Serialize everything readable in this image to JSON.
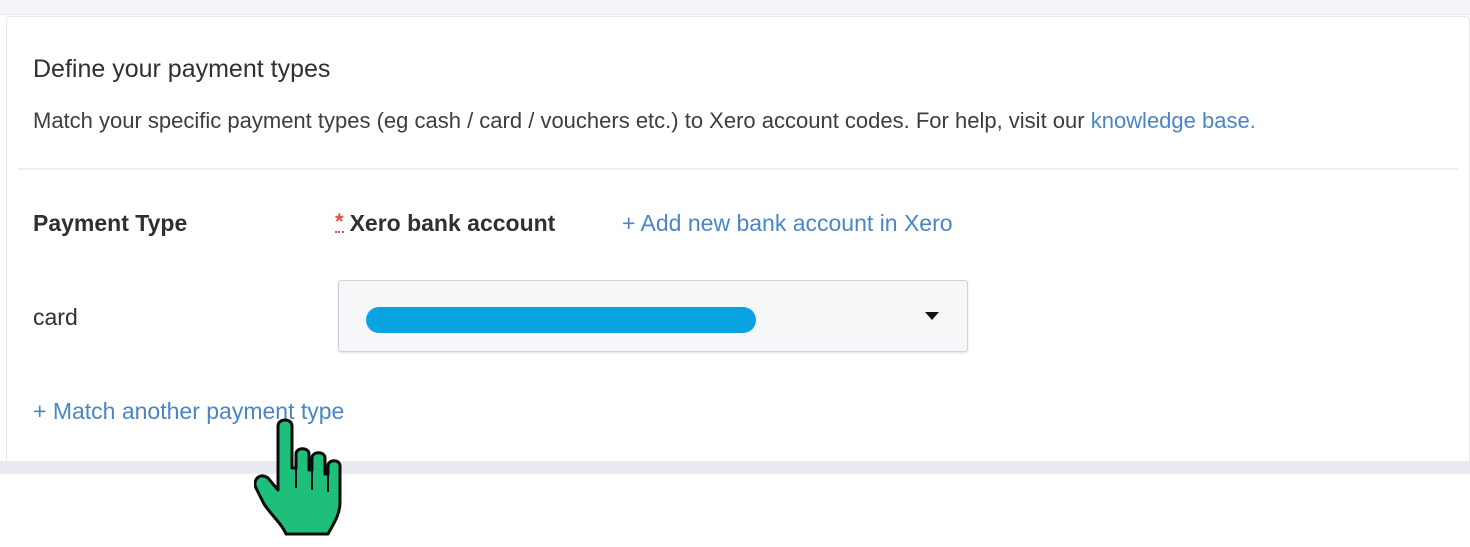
{
  "section": {
    "title": "Define your payment types",
    "description_prefix": "Match your specific payment types (eg cash / card / vouchers etc.) to Xero account codes. For help, visit our ",
    "knowledge_base_link": "knowledge base."
  },
  "table": {
    "col_payment_type": "Payment Type",
    "required_marker": "*",
    "col_bank_account": "Xero bank account",
    "add_bank_link": "+ Add new bank account in Xero",
    "rows": [
      {
        "payment_type": "card",
        "bank_account_value": ""
      }
    ]
  },
  "actions": {
    "match_another": "+ Match another payment type"
  },
  "colors": {
    "link": "#4a86c5",
    "required": "#d9534f",
    "redaction": "#0aa3e2",
    "cursor_fill": "#1dbf7b"
  },
  "icons": {
    "dropdown": "caret-down-icon",
    "cursor": "hand-pointer-cursor-icon"
  }
}
